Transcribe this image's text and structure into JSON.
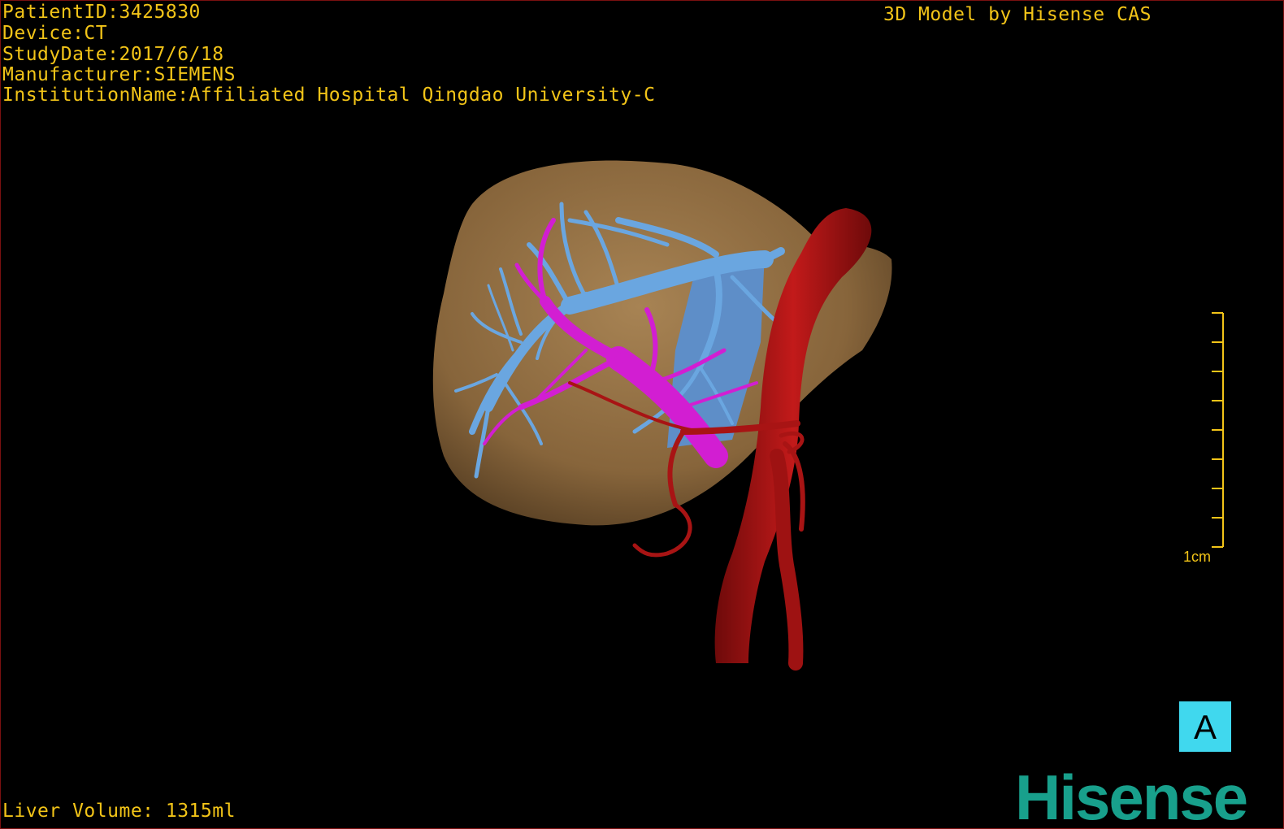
{
  "info": {
    "patient_id": "PatientID:3425830",
    "device": "Device:CT",
    "study_date": "StudyDate:2017/6/18",
    "manufacturer": "Manufacturer:SIEMENS",
    "institution": "InstitutionName:Affiliated Hospital Qingdao University-C"
  },
  "credit": "3D Model by Hisense CAS",
  "liver_volume": "Liver Volume: 1315ml",
  "scale_bar": {
    "label": "1cm"
  },
  "orientation_marker": "A",
  "brand": "Hisense",
  "colors": {
    "text": "#f2c418",
    "liver": "#a07a4a",
    "hepatic_vein": "#6aa6e0",
    "portal_vein": "#d21ed2",
    "artery": "#b01212",
    "orientation_bg": "#40d8ee",
    "brand": "#18a08c"
  }
}
